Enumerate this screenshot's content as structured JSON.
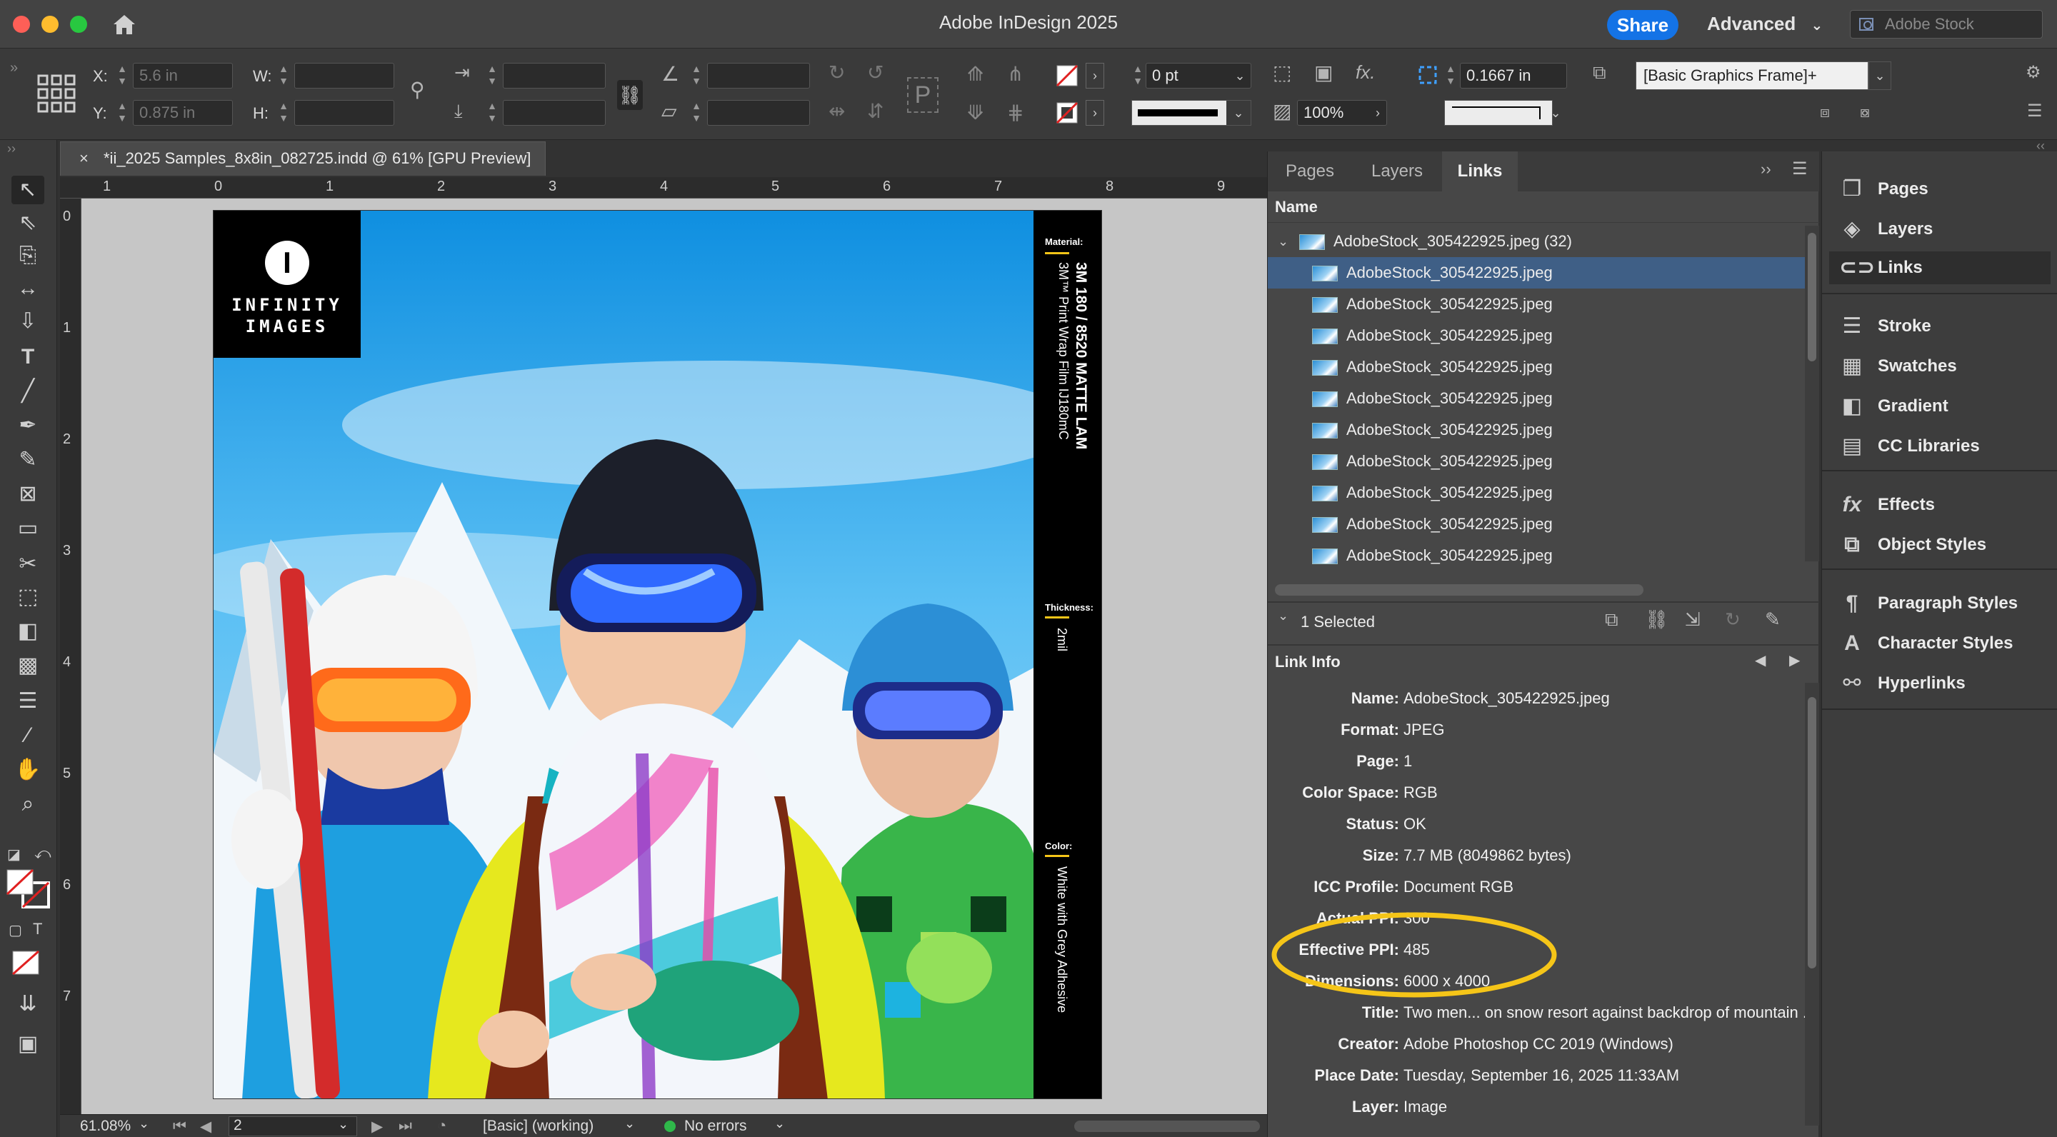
{
  "window": {
    "title": "Adobe InDesign 2025",
    "share_label": "Share",
    "workspace_label": "Advanced",
    "stock_search_placeholder": "Adobe Stock",
    "traffic_colors": [
      "#fe5f57",
      "#febc2e",
      "#28c840"
    ]
  },
  "control_bar": {
    "x_label": "X:",
    "x_value": "5.6 in",
    "y_label": "Y:",
    "y_value": "0.875 in",
    "w_label": "W:",
    "h_label": "H:",
    "stroke_weight": "0 pt",
    "opacity": "100%",
    "corner_size": "0.1667 in",
    "object_style": "[Basic Graphics Frame]+"
  },
  "document": {
    "tab_title": "*ii_2025 Samples_8x8in_082725.indd @ 61% [GPU Preview]",
    "ruler_h": [
      "1",
      "0",
      "1",
      "2",
      "3",
      "4",
      "5",
      "6",
      "7",
      "8",
      "9"
    ],
    "ruler_v": [
      "0",
      "1",
      "2",
      "3",
      "4",
      "5",
      "6",
      "7"
    ],
    "logo_line1": "INFINITY",
    "logo_line2": "IMAGES",
    "logo_mark": "I",
    "spec_material_label": "Material:",
    "spec_material_main": "3M 180 / 8520 MATTE LAM",
    "spec_material_sub": "3M™ Print Wrap Film IJ180mC",
    "spec_thickness_label": "Thickness:",
    "spec_thickness_value": "2mil",
    "spec_color_label": "Color:",
    "spec_color_value": "White with Grey Adhesive"
  },
  "status_bar": {
    "zoom": "61.08%",
    "page": "2",
    "preflight_profile": "[Basic] (working)",
    "preflight_status": "No errors"
  },
  "links_panel": {
    "tabs": [
      "Pages",
      "Layers",
      "Links"
    ],
    "active_tab": "Links",
    "column_header": "Name",
    "group_name": "AdobeStock_305422925.jpeg (32)",
    "items": [
      "AdobeStock_305422925.jpeg",
      "AdobeStock_305422925.jpeg",
      "AdobeStock_305422925.jpeg",
      "AdobeStock_305422925.jpeg",
      "AdobeStock_305422925.jpeg",
      "AdobeStock_305422925.jpeg",
      "AdobeStock_305422925.jpeg",
      "AdobeStock_305422925.jpeg",
      "AdobeStock_305422925.jpeg",
      "AdobeStock_305422925.jpeg"
    ],
    "selected_count": "1 Selected",
    "link_info_title": "Link Info",
    "link_info": [
      {
        "key": "Name:",
        "value": "AdobeStock_305422925.jpeg"
      },
      {
        "key": "Format:",
        "value": "JPEG"
      },
      {
        "key": "Page:",
        "value": "1"
      },
      {
        "key": "Color Space:",
        "value": "RGB"
      },
      {
        "key": "Status:",
        "value": "OK"
      },
      {
        "key": "Size:",
        "value": "7.7 MB (8049862 bytes)"
      },
      {
        "key": "ICC Profile:",
        "value": "Document RGB"
      },
      {
        "key": "Actual PPI:",
        "value": "300"
      },
      {
        "key": "Effective PPI:",
        "value": "485"
      },
      {
        "key": "Dimensions:",
        "value": "6000 x 4000"
      },
      {
        "key": "Title:",
        "value": "Two men... on snow resort against backdrop of mountain ."
      },
      {
        "key": "Creator:",
        "value": "Adobe Photoshop CC 2019 (Windows)"
      },
      {
        "key": "Place Date:",
        "value": "Tuesday, September 16, 2025 11:33AM"
      },
      {
        "key": "Layer:",
        "value": "Image"
      }
    ],
    "highlight_color": "#f5c518"
  },
  "dock": {
    "groups": [
      [
        {
          "label": "Pages",
          "icon": "pages-icon"
        },
        {
          "label": "Layers",
          "icon": "layers-icon"
        },
        {
          "label": "Links",
          "icon": "links-icon"
        }
      ],
      [
        {
          "label": "Stroke",
          "icon": "stroke-icon"
        },
        {
          "label": "Swatches",
          "icon": "swatches-icon"
        },
        {
          "label": "Gradient",
          "icon": "gradient-icon"
        },
        {
          "label": "CC Libraries",
          "icon": "cc-libraries-icon"
        }
      ],
      [
        {
          "label": "Effects",
          "icon": "effects-icon"
        },
        {
          "label": "Object Styles",
          "icon": "object-styles-icon"
        }
      ],
      [
        {
          "label": "Paragraph Styles",
          "icon": "paragraph-styles-icon"
        },
        {
          "label": "Character Styles",
          "icon": "character-styles-icon"
        },
        {
          "label": "Hyperlinks",
          "icon": "hyperlinks-icon"
        }
      ]
    ],
    "active": "Links"
  }
}
